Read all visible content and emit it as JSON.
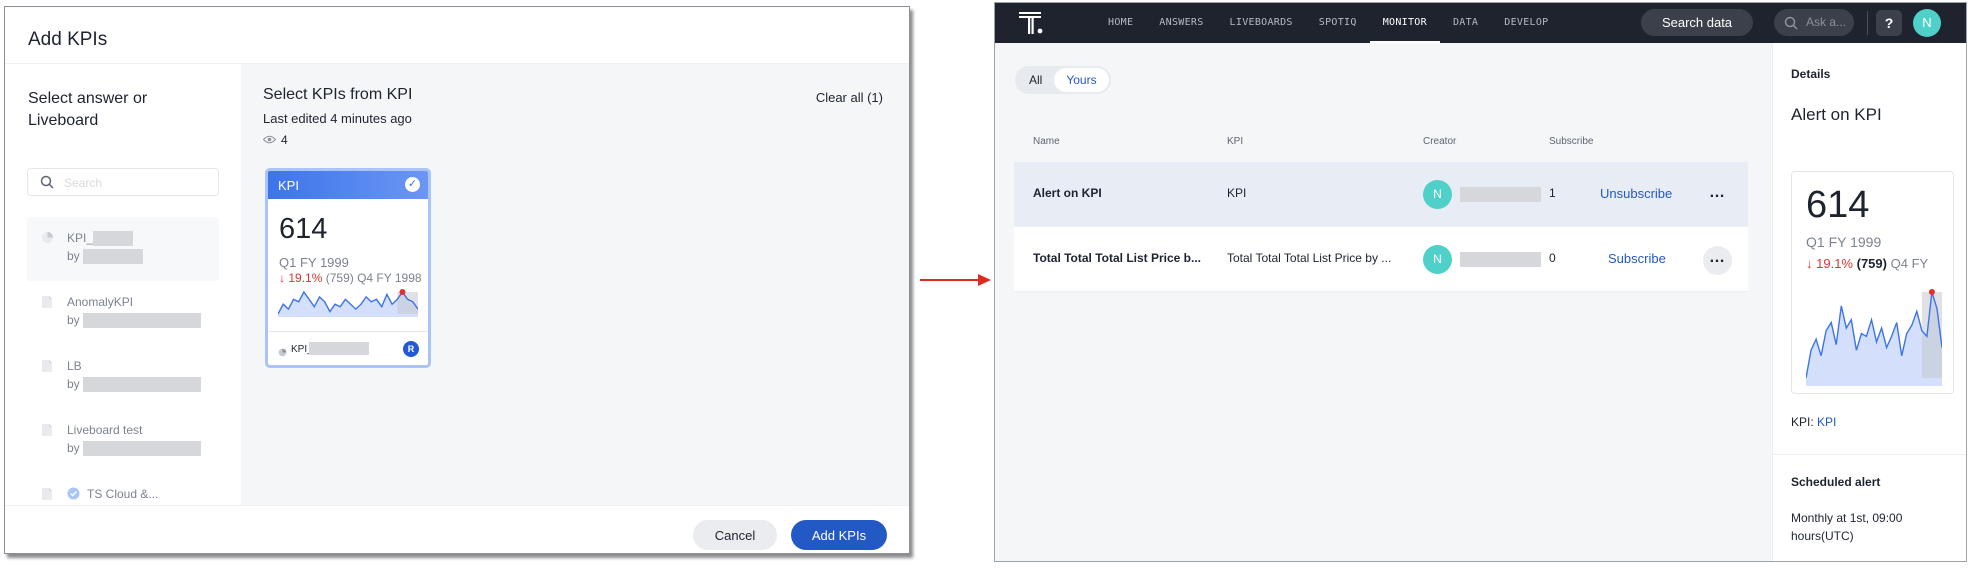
{
  "modal": {
    "title": "Add KPIs",
    "left_pane": {
      "title": "Select answer or Liveboard",
      "search_placeholder": "Search",
      "items": [
        {
          "name": "KPI_",
          "by": "by",
          "icon": "pie-chart-icon",
          "selected": true
        },
        {
          "name": "AnomalyKPI",
          "by": "by",
          "icon": "document-icon",
          "selected": false
        },
        {
          "name": "LB",
          "by": "by",
          "icon": "document-icon",
          "selected": false
        },
        {
          "name": "Liveboard test",
          "by": "by",
          "icon": "document-icon",
          "selected": false
        },
        {
          "name": "TS Cloud &...",
          "by": "by",
          "icon": "verified-icon",
          "selected": false
        }
      ]
    },
    "right_pane": {
      "title": "Select KPIs from KPI",
      "subtitle": "Last edited 4 minutes ago",
      "views": "4",
      "clear_all": "Clear all (1)",
      "card": {
        "header": "KPI",
        "value": "614",
        "period": "Q1 FY 1999",
        "change_pct": "19.1%",
        "change_abs": "(759)",
        "compare_period": "Q4 FY 1998",
        "footer_name": "KPI_",
        "avatar_initial": "R",
        "spark": [
          18,
          22,
          20,
          24,
          23,
          27,
          24,
          21,
          25,
          23,
          19,
          22,
          21,
          24,
          22,
          20,
          22,
          25,
          23,
          24,
          21,
          26,
          22,
          24,
          27,
          24,
          23,
          20
        ]
      }
    },
    "footer": {
      "cancel": "Cancel",
      "confirm": "Add KPIs"
    }
  },
  "app": {
    "nav": [
      "HOME",
      "ANSWERS",
      "LIVEBOARDS",
      "SPOTIQ",
      "MONITOR",
      "DATA",
      "DEVELOP"
    ],
    "active_nav": "MONITOR",
    "search_data": "Search data",
    "ask_placeholder": "Ask a...",
    "help": "?",
    "user_initial": "N",
    "filters": {
      "all": "All",
      "yours": "Yours"
    },
    "table": {
      "headers": {
        "name": "Name",
        "kpi": "KPI",
        "creator": "Creator",
        "subscribers": "Subscribe"
      },
      "rows": [
        {
          "name": "Alert on KPI",
          "kpi": "KPI",
          "creator_initial": "N",
          "subscribers": "1",
          "action": "Unsubscribe"
        },
        {
          "name": "Total Total Total List Price b...",
          "kpi": "Total Total Total List Price by ...",
          "creator_initial": "N",
          "subscribers": "0",
          "action": "Subscribe"
        }
      ]
    },
    "details": {
      "heading": "Details",
      "title": "Alert on KPI",
      "value": "614",
      "period": "Q1 FY 1999",
      "change_pct": "19.1%",
      "change_abs": "(759)",
      "compare_period": "Q4 FY",
      "kpi_label": "KPI:",
      "kpi_link": "KPI",
      "scheduled_heading": "Scheduled alert",
      "scheduled_text": "Monthly at 1st, 09:00 hours(UTC)",
      "spark": [
        20,
        30,
        34,
        28,
        37,
        40,
        32,
        46,
        38,
        41,
        30,
        36,
        35,
        41,
        33,
        38,
        31,
        35,
        40,
        28,
        36,
        39,
        44,
        37,
        35,
        51,
        45,
        31
      ]
    }
  },
  "colors": {
    "accent": "#2359c4",
    "kpi_header": "#3d74ea",
    "negative": "#e03131",
    "topbar": "#1f232d",
    "avatar_teal": "#4fd1c9"
  }
}
